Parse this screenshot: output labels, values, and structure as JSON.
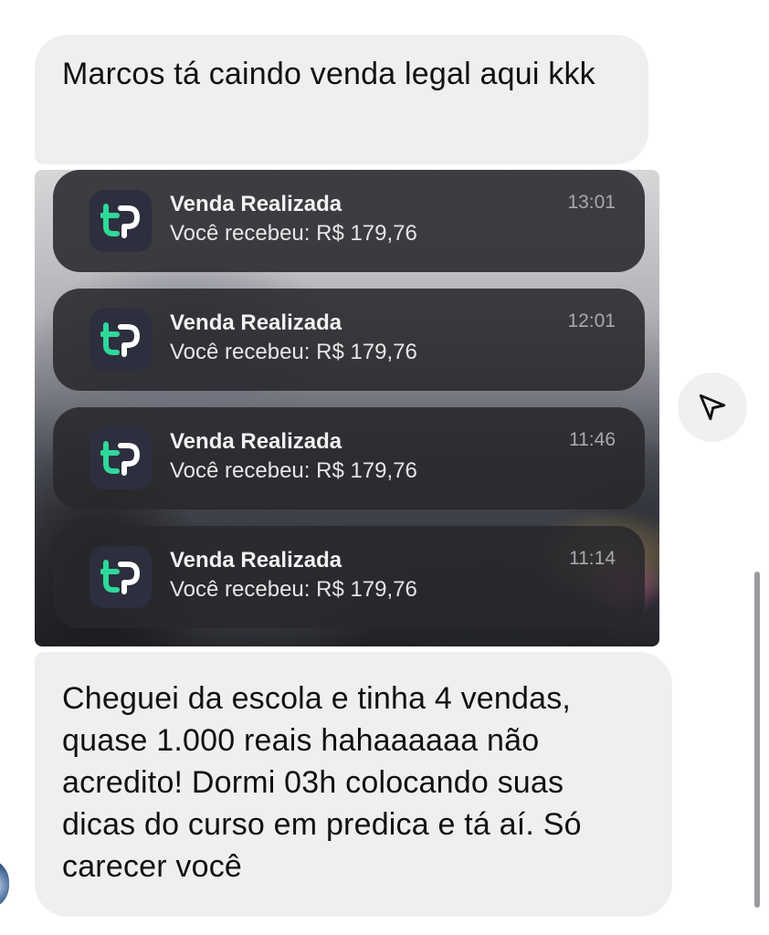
{
  "messages": {
    "top_text": "Marcos tá caindo venda  legal aqui kkk",
    "bottom_text": "Cheguei da escola e tinha 4 vendas, quase 1.000 reais hahaaaaaa não acredito! Dormi 03h colocando suas dicas do curso em predica e tá aí. Só carecer você"
  },
  "notifications": [
    {
      "title": "Venda Realizada",
      "body": "Você recebeu: R$ 179,76",
      "time": "13:01"
    },
    {
      "title": "Venda Realizada",
      "body": "Você recebeu: R$ 179,76",
      "time": "12:01"
    },
    {
      "title": "Venda Realizada",
      "body": "Você recebeu: R$ 179,76",
      "time": "11:46"
    },
    {
      "title": "Venda Realizada",
      "body": "Você recebeu: R$ 179,76",
      "time": "11:14"
    }
  ],
  "icons": {
    "app": "tp-app-icon",
    "share": "paper-plane-icon"
  },
  "colors": {
    "bubble_bg": "#efeff1",
    "notification_bg": "#28282c",
    "app_icon_bg": "#2d2e3e",
    "app_icon_green": "#2fd89a",
    "app_icon_white": "#ffffff"
  }
}
